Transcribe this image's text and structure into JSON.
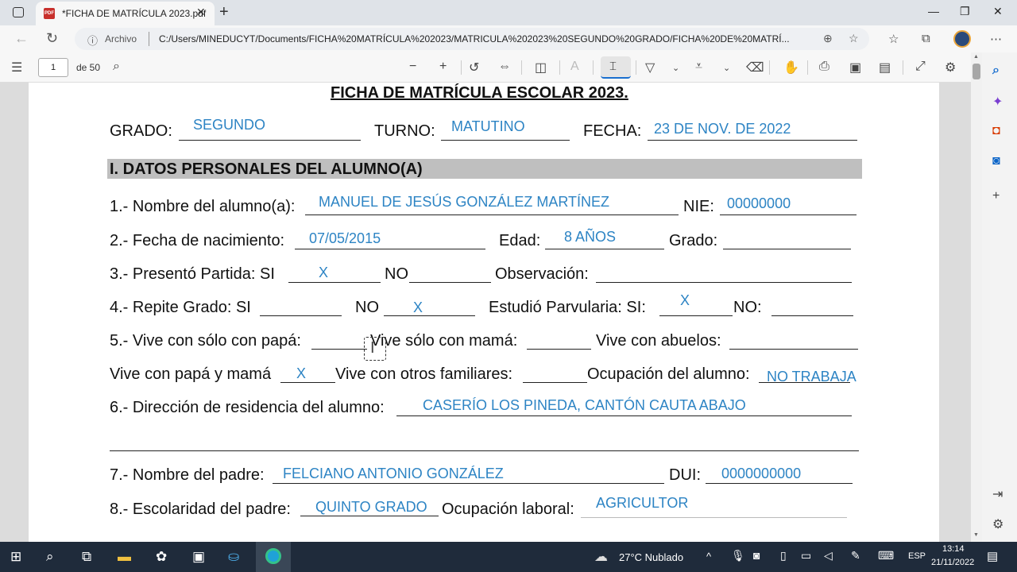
{
  "browser": {
    "tab_title": "*FICHA DE MATRÍCULA 2023.pdf",
    "url_label": "Archivo",
    "url_path": "C:/Users/MINEDUCYT/Documents/FICHA%20MATRÍCULA%202023/MATRICULA%202023%20SEGUNDO%20GRADO/FICHA%20DE%20MATRÍ..."
  },
  "pdf_toolbar": {
    "page_current": "1",
    "page_total": "de 50"
  },
  "document": {
    "title": "FICHA DE MATRÍCULA ESCOLAR 2023.",
    "grado_label": "GRADO:",
    "grado_value": "SEGUNDO",
    "turno_label": "TURNO:",
    "turno_value": "MATUTINO",
    "fecha_label": "FECHA:",
    "fecha_value": "23 DE NOV. DE 2022",
    "section1_title": "I. DATOS PERSONALES DEL ALUMNO(A)",
    "q1_label": "1.- Nombre del alumno(a):",
    "q1_value": "MANUEL DE JESÚS GONZÁLEZ MARTÍNEZ",
    "nie_label": "NIE:",
    "nie_value": "00000000",
    "q2_label": "2.- Fecha de nacimiento:",
    "q2_value": "07/05/2015",
    "edad_label": "Edad:",
    "edad_value": "8 AÑOS",
    "grado2_label": "Grado:",
    "q3_label": "3.- Presentó Partida:   SI",
    "q3_si_value": "X",
    "q3_no_label": "NO",
    "obs_label": "Observación:",
    "q4_label": "4.- Repite Grado:  SI",
    "q4_no_label": "NO",
    "q4_no_value": "X",
    "parv_label": "Estudió Parvularia:  SI:",
    "parv_si_value": "X",
    "parv_no_label": "NO:",
    "q5_label": "5.- Vive con sólo con papá:",
    "q5_mama_label": "Vive sólo con mamá:",
    "q5_abuelos_label": "Vive con abuelos:",
    "q5b_label": "Vive con papá y mamá",
    "q5b_value": "X",
    "q5b_otros_label": "Vive con otros familiares:",
    "ocup_label": "Ocupación del alumno:",
    "ocup_value": "NO TRABAJA",
    "q6_label": "6.- Dirección de residencia del alumno:",
    "q6_value": "CASERÍO LOS PINEDA, CANTÓN CAUTA ABAJO",
    "q7_label": "7.- Nombre del padre:",
    "q7_value": "FELCIANO ANTONIO GONZÁLEZ",
    "dui_label": "DUI:",
    "dui_value": "0000000000",
    "q8_label": "8.- Escolaridad del padre:",
    "q8_value": "QUINTO GRADO",
    "ocup_lab_label": "Ocupación laboral:",
    "ocup_lab_value": "AGRICULTOR"
  },
  "taskbar": {
    "weather": "27°C  Nublado",
    "lang": "ESP",
    "time": "13:14",
    "date": "21/11/2022"
  }
}
